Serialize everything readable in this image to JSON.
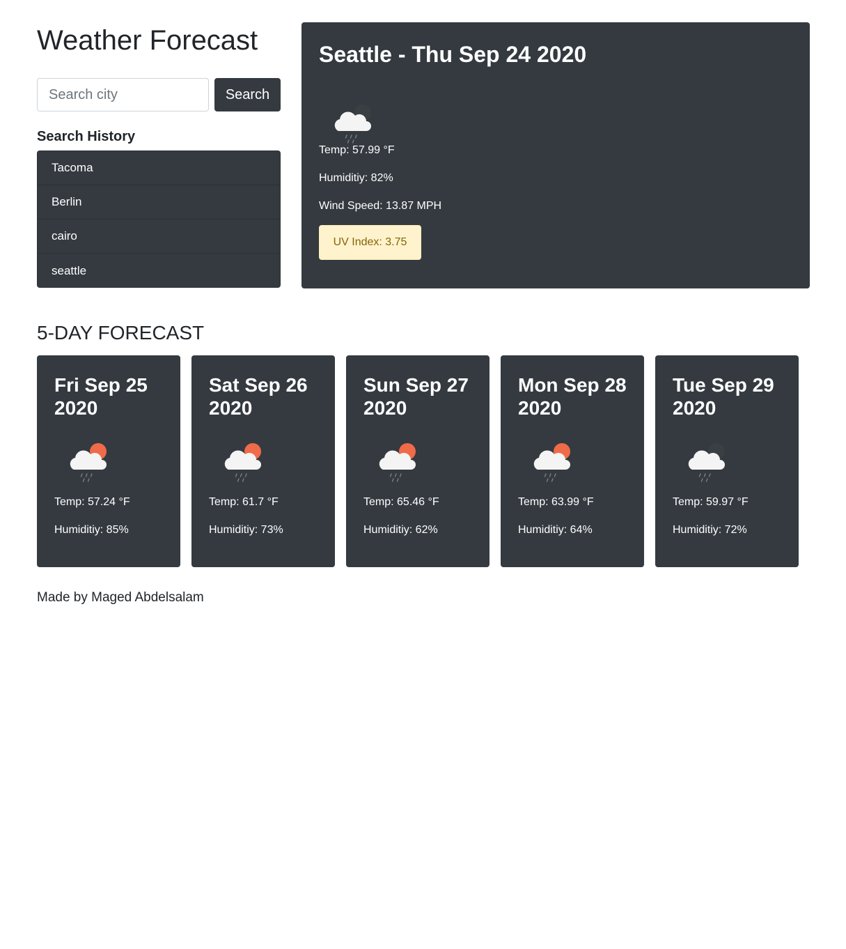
{
  "app": {
    "title": "Weather Forecast"
  },
  "search": {
    "placeholder": "Search city",
    "value": "",
    "button_label": "Search"
  },
  "history": {
    "heading": "Search History",
    "items": [
      "Tacoma",
      "Berlin",
      "cairo",
      "seattle"
    ]
  },
  "current": {
    "title": "Seattle - Thu Sep 24 2020",
    "icon": "rain-cloud-night-icon",
    "temp": "Temp: 57.99 °F",
    "humidity": "Humiditiy: 82%",
    "wind": "Wind Speed: 13.87 MPH",
    "uv": "UV Index: 3.75"
  },
  "forecast": {
    "heading": "5-DAY FORECAST",
    "days": [
      {
        "date": "Fri Sep 25 2020",
        "icon": "rain-cloud-sun-icon",
        "temp": "Temp: 57.24 °F",
        "humidity": "Humiditiy: 85%"
      },
      {
        "date": "Sat Sep 26 2020",
        "icon": "rain-cloud-sun-icon",
        "temp": "Temp: 61.7 °F",
        "humidity": "Humiditiy: 73%"
      },
      {
        "date": "Sun Sep 27 2020",
        "icon": "rain-cloud-sun-icon",
        "temp": "Temp: 65.46 °F",
        "humidity": "Humiditiy: 62%"
      },
      {
        "date": "Mon Sep 28 2020",
        "icon": "rain-cloud-sun-icon",
        "temp": "Temp: 63.99 °F",
        "humidity": "Humiditiy: 64%"
      },
      {
        "date": "Tue Sep 29 2020",
        "icon": "rain-cloud-night-icon",
        "temp": "Temp: 59.97 °F",
        "humidity": "Humiditiy: 72%"
      }
    ]
  },
  "footer": {
    "credit": "Made by Maged Abdelsalam"
  },
  "colors": {
    "card_bg": "#343a40",
    "uv_bg": "#fff3cd",
    "uv_text": "#856404",
    "sun": "#ef6b4a",
    "moon": "#3a3f44"
  }
}
